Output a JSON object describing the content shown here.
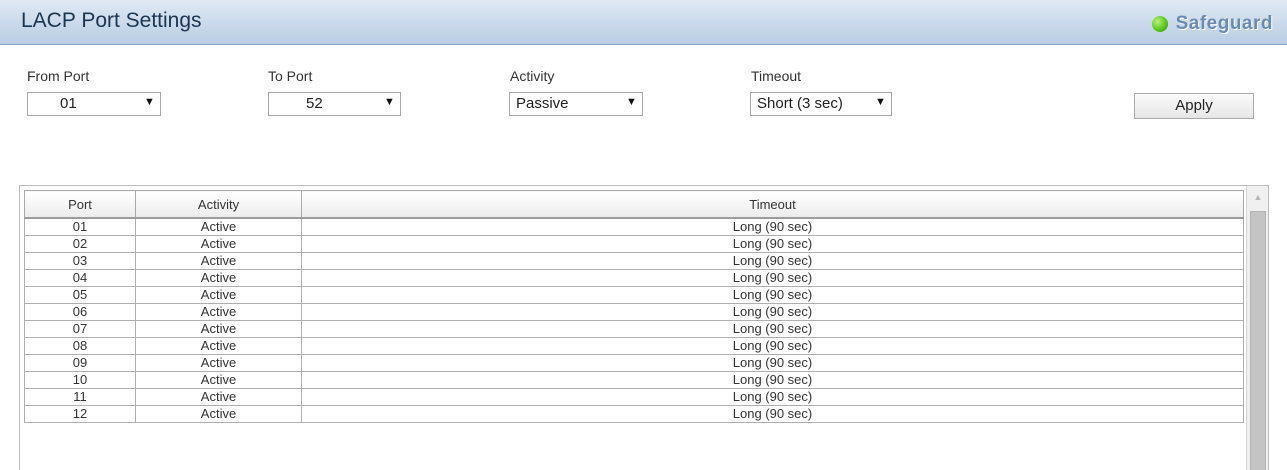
{
  "header": {
    "title": "LACP Port Settings",
    "safeguard": "Safeguard"
  },
  "form": {
    "from_port": {
      "label": "From Port",
      "value": "01"
    },
    "to_port": {
      "label": "To Port",
      "value": "52"
    },
    "activity": {
      "label": "Activity",
      "value": "Passive"
    },
    "timeout": {
      "label": "Timeout",
      "value": "Short (3 sec)"
    },
    "apply_label": "Apply",
    "arrow": "▼"
  },
  "table": {
    "columns": [
      "Port",
      "Activity",
      "Timeout"
    ],
    "rows": [
      [
        "01",
        "Active",
        "Long (90 sec)"
      ],
      [
        "02",
        "Active",
        "Long (90 sec)"
      ],
      [
        "03",
        "Active",
        "Long (90 sec)"
      ],
      [
        "04",
        "Active",
        "Long (90 sec)"
      ],
      [
        "05",
        "Active",
        "Long (90 sec)"
      ],
      [
        "06",
        "Active",
        "Long (90 sec)"
      ],
      [
        "07",
        "Active",
        "Long (90 sec)"
      ],
      [
        "08",
        "Active",
        "Long (90 sec)"
      ],
      [
        "09",
        "Active",
        "Long (90 sec)"
      ],
      [
        "10",
        "Active",
        "Long (90 sec)"
      ],
      [
        "11",
        "Active",
        "Long (90 sec)"
      ],
      [
        "12",
        "Active",
        "Long (90 sec)"
      ]
    ]
  },
  "scrollbar": {
    "up_glyph": "▲"
  },
  "colors": {
    "safeguard_dot": "#5cc61f",
    "title_bar": "#b9cde3"
  }
}
